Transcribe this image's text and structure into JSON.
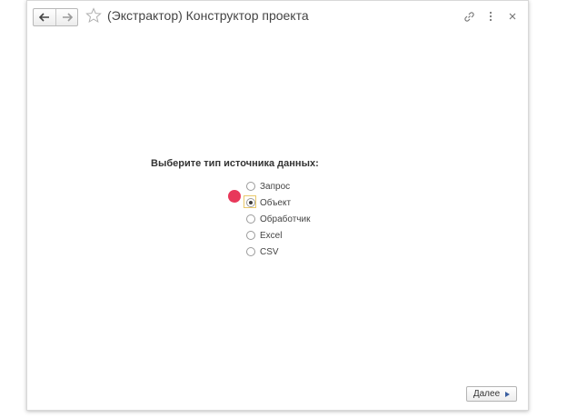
{
  "window": {
    "title": "(Экстрактор) Конструктор проекта",
    "icons": [
      "back-arrow-icon",
      "forward-arrow-icon",
      "star-icon",
      "link-icon",
      "more-vertical-icon",
      "close-icon"
    ]
  },
  "form": {
    "prompt": "Выберите тип источника данных:",
    "options": [
      {
        "label": "Запрос",
        "selected": false
      },
      {
        "label": "Объект",
        "selected": true
      },
      {
        "label": "Обработчик",
        "selected": false
      },
      {
        "label": "Excel",
        "selected": false
      },
      {
        "label": "CSV",
        "selected": false
      }
    ]
  },
  "footer": {
    "next_label": "Далее"
  },
  "colors": {
    "marker": "#e8385a",
    "focus": "#e8c86a",
    "next_arrow": "#3a5fa0"
  }
}
